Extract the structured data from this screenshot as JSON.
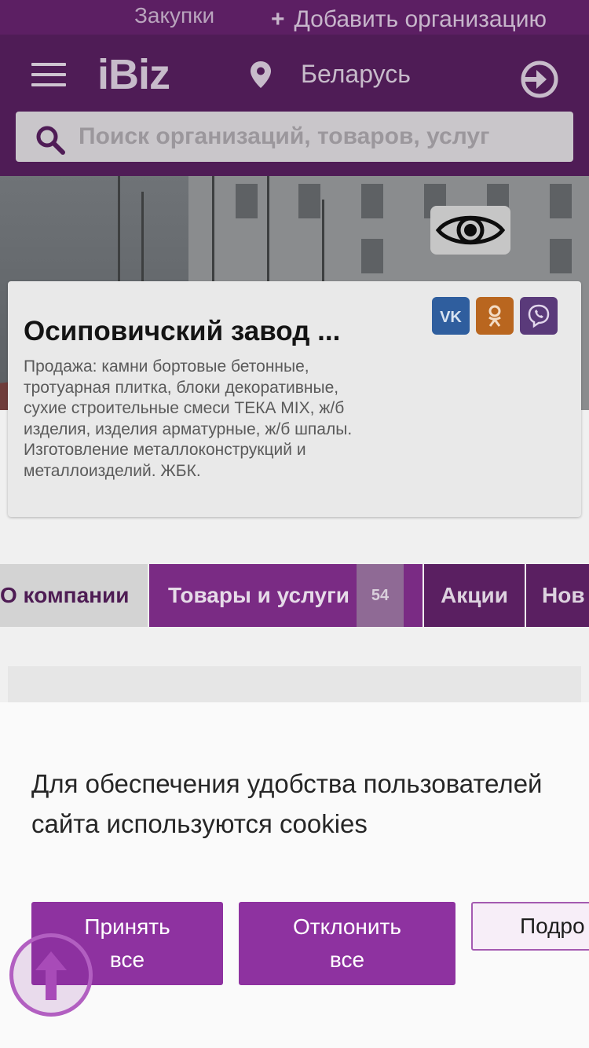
{
  "topbar": {
    "purchases_label": "Закупки",
    "add_org_label": "Добавить организацию"
  },
  "header": {
    "logo": "iBiz",
    "region": "Беларусь",
    "search_placeholder": "Поиск организаций, товаров, услуг"
  },
  "company": {
    "title": "Осиповичский завод ...",
    "description": "Продажа: камни бортовые бетонные, тротуарная плитка, блоки декоративные, сухие строительные смеси ТЕКА MIX, ж/б изделия, изделия арматурные, ж/б шпалы. Изготовление металлоконструкций и металлоизделий. ЖБК.",
    "social": [
      "vk-icon",
      "odnoklassniki-icon",
      "viber-icon"
    ]
  },
  "tabs": {
    "about": "О компании",
    "goods": "Товары и услуги",
    "goods_count": "54",
    "promo": "Акции",
    "news": "Нов"
  },
  "cookie": {
    "text": "Для обеспечения удобства пользователей сайта используются cookies",
    "accept_line1": "Принять",
    "accept_line2": "все",
    "decline_line1": "Отклонить",
    "decline_line2": "все",
    "details": "Подро"
  },
  "colors": {
    "brand_purple": "#8e32a0",
    "header_bg": "#4f1c56"
  }
}
